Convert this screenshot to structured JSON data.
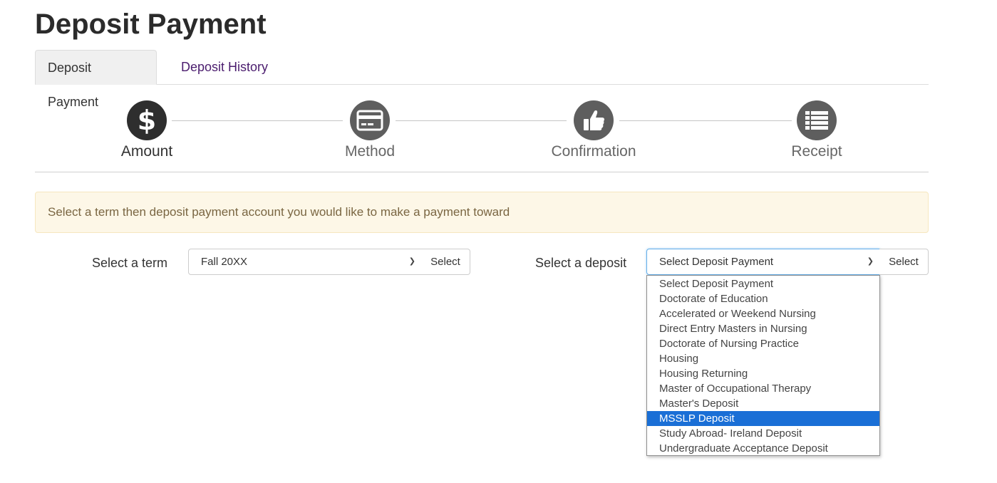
{
  "page": {
    "title": "Deposit Payment"
  },
  "tabs": [
    {
      "label": "Deposit Payment",
      "active": true
    },
    {
      "label": "Deposit History",
      "active": false
    }
  ],
  "steps": [
    {
      "label": "Amount",
      "icon": "dollar-icon",
      "active": true
    },
    {
      "label": "Method",
      "icon": "credit-card-icon",
      "active": false
    },
    {
      "label": "Confirmation",
      "icon": "thumbs-up-icon",
      "active": false
    },
    {
      "label": "Receipt",
      "icon": "list-icon",
      "active": false
    }
  ],
  "alert": {
    "text": "Select a term then deposit payment account you would like to make a payment toward"
  },
  "term": {
    "label": "Select a term",
    "value": "Fall 20XX",
    "button": "Select"
  },
  "deposit": {
    "label": "Select a deposit",
    "value": "Select Deposit Payment",
    "button": "Select",
    "options": [
      "Select Deposit Payment",
      "Doctorate of Education",
      "Accelerated or Weekend Nursing",
      "Direct Entry Masters in Nursing",
      "Doctorate of Nursing Practice",
      "Housing",
      "Housing Returning",
      "Master of Occupational Therapy",
      "Master's Deposit",
      "MSSLP Deposit",
      "Study Abroad- Ireland Deposit",
      "Undergraduate Acceptance Deposit"
    ],
    "highlighted_option": "MSSLP Deposit"
  },
  "colors": {
    "active_step": "#2e2e2e",
    "inactive_step": "#5e5e5e",
    "tab_link": "#4b1d6e",
    "alert_bg": "#fdf7e7",
    "highlight": "#1a6fd6"
  }
}
